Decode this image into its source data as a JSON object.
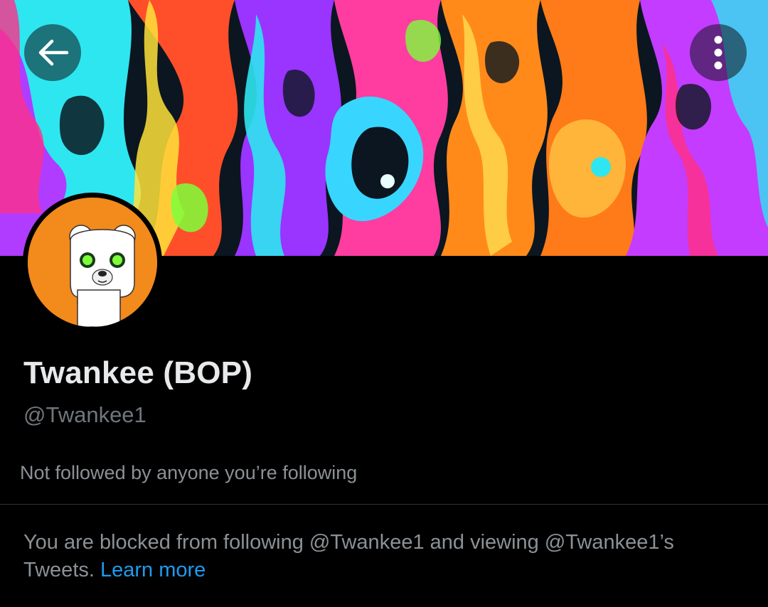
{
  "header": {
    "back_icon": "arrow-left-icon",
    "more_icon": "more-vertical-icon"
  },
  "banner": {
    "description_colors": [
      "#2ee6f0",
      "#ff8a1a",
      "#b03cff",
      "#ff2f8a",
      "#7cff3a",
      "#1a1a1a"
    ]
  },
  "avatar": {
    "background_color": "#f28a1c"
  },
  "profile": {
    "display_name": "Twankee (BOP)",
    "handle": "@Twankee1",
    "followed_by": "Not followed by anyone you’re following"
  },
  "blocked_notice": {
    "text": "You are blocked from following @Twankee1 and viewing @Twankee1’s Tweets. ",
    "link_label": "Learn more",
    "link_color": "#1d9bf0"
  }
}
